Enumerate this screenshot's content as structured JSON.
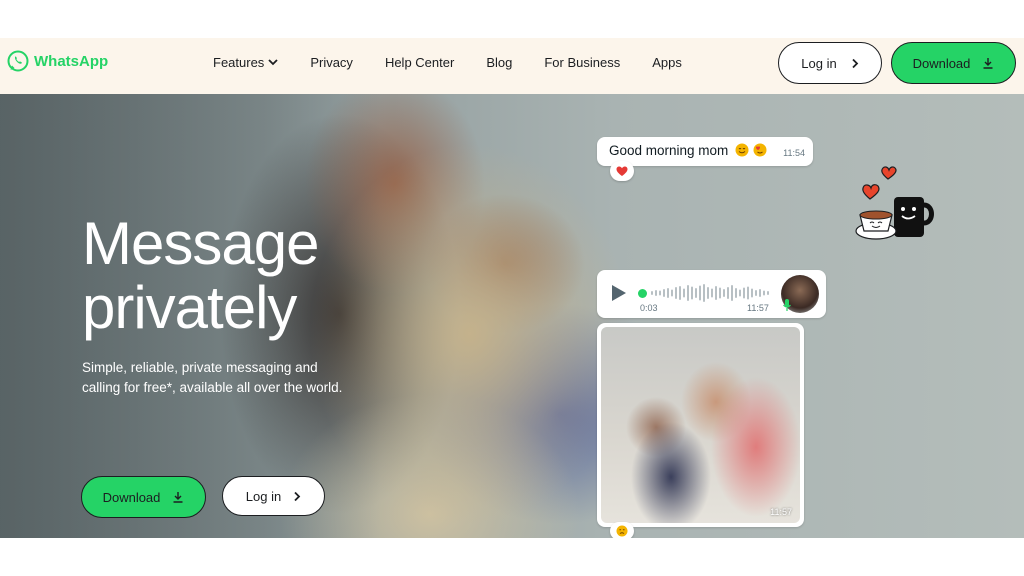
{
  "nav": {
    "brand": "WhatsApp",
    "links": [
      "Features",
      "Privacy",
      "Help Center",
      "Blog",
      "For Business",
      "Apps"
    ],
    "login_label": "Log in",
    "download_label": "Download"
  },
  "hero": {
    "title_line1": "Message",
    "title_line2": "privately",
    "subtitle": "Simple, reliable, private messaging and calling for free*, available all over the world.",
    "download_label": "Download",
    "login_label": "Log in"
  },
  "chat": {
    "text_message": "Good morning mom",
    "text_time": "11:54",
    "voice_duration": "0:03",
    "voice_time": "11:57",
    "photo_time": "11:57"
  },
  "colors": {
    "brand_green": "#25d366",
    "nav_bg": "#fcf5eb",
    "ink": "#1c1e21"
  },
  "icons": [
    "whatsapp-logo-icon",
    "chevron-down-icon",
    "chevron-right-icon",
    "download-icon",
    "play-icon",
    "mic-icon",
    "heart-icon",
    "coffee-sticker-icon"
  ]
}
